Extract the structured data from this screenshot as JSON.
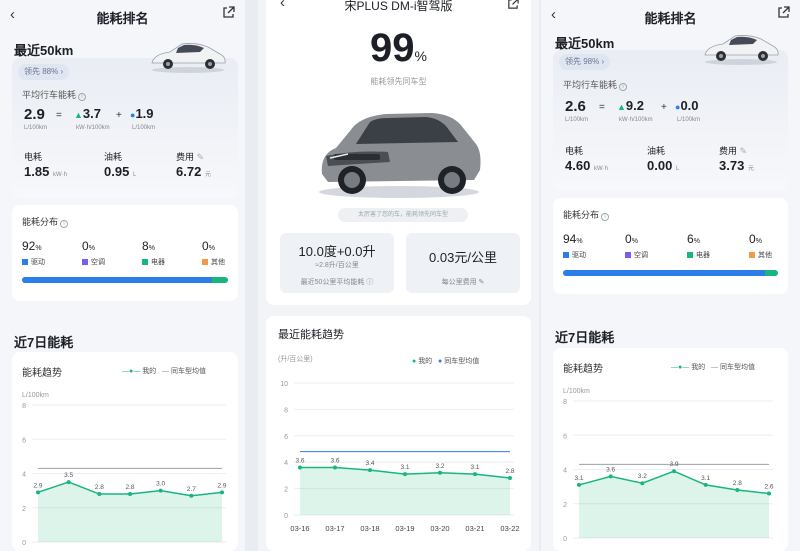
{
  "colors": {
    "drive": "#2b7de9",
    "ac": "#7b5cf0",
    "electric": "#18b67c",
    "other": "#f39a4a",
    "line_mine": "#18b67c",
    "line_avg": "#2b7de9"
  },
  "left": {
    "nav_title": "能耗排名",
    "recent_title": "最近50km",
    "badge": "领先 88%",
    "avg_label": "平均行车能耗",
    "total": "2.9",
    "total_unit": "L/100km",
    "elec": "3.7",
    "elec_unit": "kW·h/100km",
    "fuel": "1.9",
    "fuel_unit": "L/100km",
    "eq": "=",
    "plus": "+",
    "stats": [
      {
        "label": "电耗",
        "value": "1.85",
        "unit": "kW·h"
      },
      {
        "label": "油耗",
        "value": "0.95",
        "unit": "L"
      },
      {
        "label": "费用",
        "value": "6.72",
        "unit": "元"
      }
    ],
    "dist_title": "能耗分布",
    "dist": [
      {
        "value": "92",
        "pct": "%",
        "label": "驱动"
      },
      {
        "value": "0",
        "pct": "%",
        "label": "空调"
      },
      {
        "value": "8",
        "pct": "%",
        "label": "电器"
      },
      {
        "value": "0",
        "pct": "%",
        "label": "其他"
      }
    ],
    "dist_fractions": [
      0.92,
      0.0,
      0.08,
      0.0
    ],
    "week_title": "近7日能耗",
    "chart_title": "能耗趋势",
    "legend_mine": "我的",
    "legend_avg": "同车型均值",
    "y_unit": "L/100km"
  },
  "middle": {
    "nav_title": "宋PLUS DM-i智驾版",
    "percent": "99",
    "percent_sign": "%",
    "sub": "能耗领先同车型",
    "note": "太厉害了您的车，能耗领先同车型",
    "stat1_value": "10.0度+0.0升",
    "stat1_sub1": "≈2.8升/百公里",
    "stat1_sub2": "最近50公里平均能耗",
    "stat2_value": "0.03元/公里",
    "stat2_sub": "每公里费用",
    "trend_title": "最近能耗趋势",
    "y_unit": "(升/百公里)",
    "legend_mine": "我的",
    "legend_avg": "同车型均值"
  },
  "right": {
    "nav_title": "能耗排名",
    "recent_title": "最近50km",
    "badge": "领先 98%",
    "avg_label": "平均行车能耗",
    "total": "2.6",
    "total_unit": "L/100km",
    "elec": "9.2",
    "elec_unit": "kW·h/100km",
    "fuel": "0.0",
    "fuel_unit": "L/100km",
    "eq": "=",
    "plus": "+",
    "stats": [
      {
        "label": "电耗",
        "value": "4.60",
        "unit": "kW·h"
      },
      {
        "label": "油耗",
        "value": "0.00",
        "unit": "L"
      },
      {
        "label": "费用",
        "value": "3.73",
        "unit": "元"
      }
    ],
    "dist_title": "能耗分布",
    "dist": [
      {
        "value": "94",
        "pct": "%",
        "label": "驱动"
      },
      {
        "value": "0",
        "pct": "%",
        "label": "空调"
      },
      {
        "value": "6",
        "pct": "%",
        "label": "电器"
      },
      {
        "value": "0",
        "pct": "%",
        "label": "其他"
      }
    ],
    "dist_fractions": [
      0.94,
      0.0,
      0.06,
      0.0
    ],
    "week_title": "近7日能耗",
    "chart_title": "能耗趋势",
    "legend_mine": "我的",
    "legend_avg": "同车型均值",
    "y_unit": "L/100km"
  },
  "chart_data": [
    {
      "type": "line",
      "title": "能耗趋势",
      "ylabel": "L/100km",
      "ylim": [
        0,
        8
      ],
      "yticks": [
        "0",
        "2",
        "4",
        "6",
        "8"
      ],
      "series": [
        {
          "name": "我的",
          "values": [
            2.9,
            3.5,
            2.8,
            2.8,
            3.0,
            2.7,
            2.9
          ]
        },
        {
          "name": "同车型均值",
          "values": [
            4.3,
            4.3,
            4.3,
            4.3,
            4.3,
            4.3,
            4.3
          ]
        }
      ],
      "value_labels": [
        "2.9",
        "3.5",
        "2.8",
        "2.8",
        "3.0",
        "2.7",
        "2.9"
      ]
    },
    {
      "type": "line",
      "title": "最近能耗趋势",
      "ylabel": "(升/百公里)",
      "ylim": [
        0,
        10
      ],
      "yticks": [
        "0",
        "2",
        "4",
        "6",
        "8",
        "10"
      ],
      "categories": [
        "03-16",
        "03-17",
        "03-18",
        "03-19",
        "03-20",
        "03-21",
        "03-22"
      ],
      "series": [
        {
          "name": "我的",
          "values": [
            3.6,
            3.6,
            3.4,
            3.1,
            3.2,
            3.1,
            2.8
          ]
        },
        {
          "name": "同车型均值",
          "values": [
            4.8,
            4.8,
            4.8,
            4.8,
            4.8,
            4.8,
            4.8
          ]
        }
      ],
      "value_labels": [
        "3.6",
        "3.6",
        "3.4",
        "3.1",
        "3.2",
        "3.1",
        "2.8"
      ]
    },
    {
      "type": "line",
      "title": "能耗趋势",
      "ylabel": "L/100km",
      "ylim": [
        0,
        8
      ],
      "yticks": [
        "0",
        "2",
        "4",
        "6",
        "8"
      ],
      "series": [
        {
          "name": "我的",
          "values": [
            3.1,
            3.6,
            3.2,
            3.9,
            3.1,
            2.8,
            2.6
          ]
        },
        {
          "name": "同车型均值",
          "values": [
            4.3,
            4.3,
            4.3,
            4.3,
            4.3,
            4.3,
            4.3
          ]
        }
      ],
      "value_labels": [
        "3.1",
        "3.6",
        "3.2",
        "3.9",
        "3.1",
        "2.8",
        "2.6"
      ]
    }
  ]
}
